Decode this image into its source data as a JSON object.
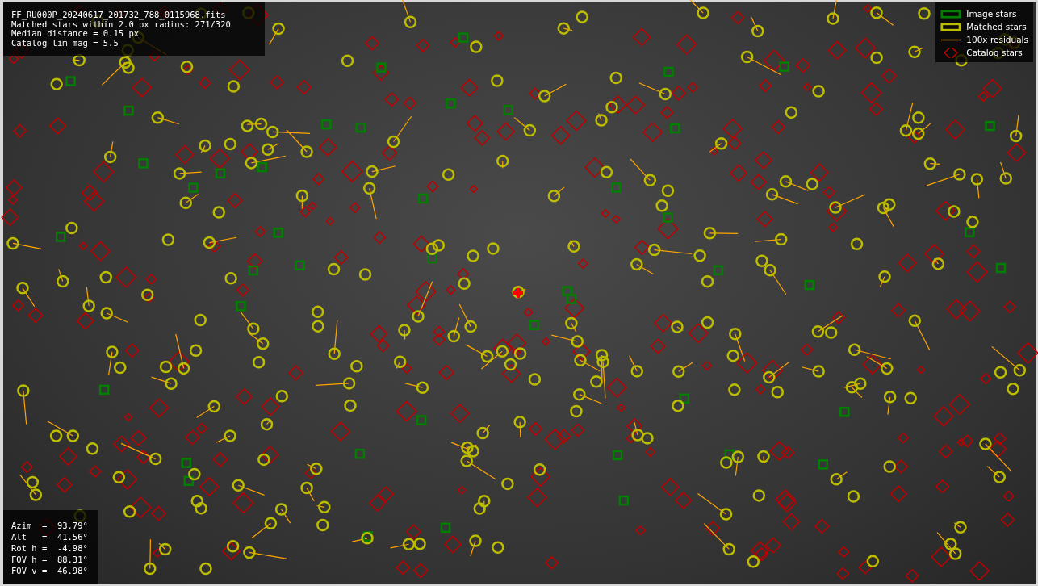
{
  "header_info": {
    "lines": [
      "FF_RU000P_20240617_201732_788_0115968.fits",
      "Matched stars within 2.0 px radius: 271/320",
      "Median distance = 0.15 px",
      "Catalog lim mag = 5.5"
    ]
  },
  "legend": {
    "items": [
      {
        "kind": "image",
        "label": "Image stars"
      },
      {
        "kind": "matched",
        "label": "Matched stars"
      },
      {
        "kind": "residual",
        "label": "100x residuals"
      },
      {
        "kind": "catalog",
        "label": "Catalog stars"
      }
    ]
  },
  "pointing_info": {
    "lines": [
      "Azim  =  93.79°",
      "Alt   =  41.56°",
      "Rot h =  -4.98°",
      "FOV h =  88.31°",
      "FOV v =  46.98°"
    ]
  }
}
